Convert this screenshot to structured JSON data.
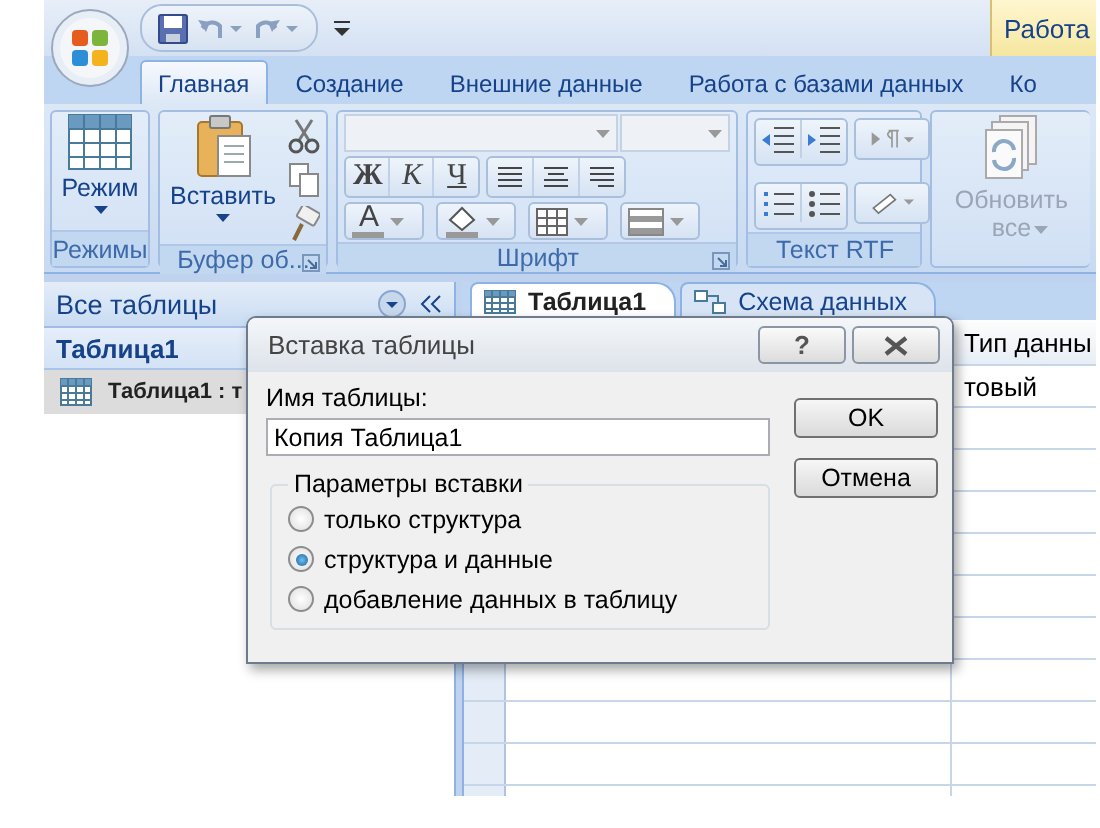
{
  "contextual_tab": "Работа",
  "tabs": [
    {
      "label": "Главная",
      "selected": true
    },
    {
      "label": "Создание",
      "selected": false
    },
    {
      "label": "Внешние данные",
      "selected": false
    },
    {
      "label": "Работа с базами данных",
      "selected": false
    },
    {
      "label": "Ко",
      "selected": false
    }
  ],
  "ribbon_groups": [
    {
      "kind": "views",
      "label": "Режимы",
      "button": "Режим",
      "launcher": false
    },
    {
      "kind": "clipboard",
      "label": "Буфер об...",
      "button": "Вставить",
      "launcher": true
    },
    {
      "kind": "font",
      "label": "Шрифт",
      "format_buttons": [
        "Ж",
        "К",
        "Ч"
      ],
      "color_letter": "A",
      "launcher": true
    },
    {
      "kind": "rtf",
      "label": "Текст RTF",
      "launcher": false
    },
    {
      "kind": "records",
      "button": "Обновить все",
      "disabled": true
    }
  ],
  "navigation": {
    "title": "Все таблицы",
    "groups": [
      {
        "title": "Таблица1",
        "items": [
          {
            "label": "Таблица1 : т",
            "selected": true
          }
        ]
      }
    ]
  },
  "doc_tabs": [
    {
      "label": "Таблица1",
      "selected": true
    },
    {
      "label": "Схема данных",
      "selected": false
    }
  ],
  "grid": {
    "columns": [
      "Тип данны"
    ],
    "rows": [
      [
        "товый"
      ]
    ]
  },
  "dialog": {
    "title": "Вставка таблицы",
    "help_button": "?",
    "name_label": "Имя таблицы:",
    "name_value": "Копия Таблица1",
    "options_title": "Параметры вставки",
    "options": [
      {
        "label": "только структура",
        "selected": false
      },
      {
        "label": "структура и данные",
        "selected": true
      },
      {
        "label": "добавление данных в таблицу",
        "selected": false
      }
    ],
    "buttons": [
      "OK",
      "Отмена"
    ]
  }
}
